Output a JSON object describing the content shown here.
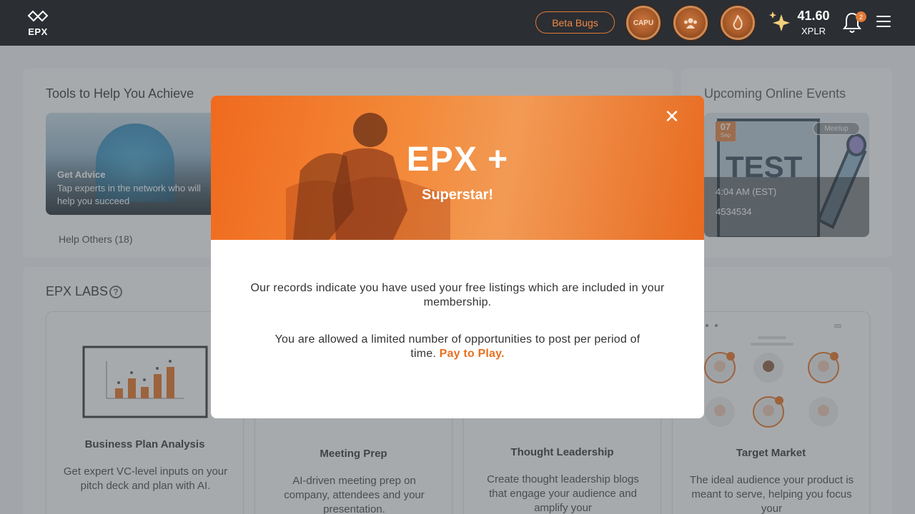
{
  "topbar": {
    "logo_text": "EPX",
    "beta_label": "Beta Bugs",
    "badges": [
      "CAPU",
      "group-badge",
      "flame-badge"
    ],
    "xp_value": "41.60",
    "xp_unit": "XPLR",
    "notification_count": "2"
  },
  "tools": {
    "title": "Tools to Help You Achieve",
    "card_title": "Get Advice",
    "card_desc": "Tap experts in the network who will help you succeed",
    "help_others": "Help Others (18)"
  },
  "events": {
    "title": "Upcoming Online Events",
    "day": "07",
    "month": "Sep",
    "tag": "Meetup",
    "time": "4:04 AM (EST)",
    "name": "4534534"
  },
  "labs": {
    "title": "EPX LABS",
    "help_icon": "?",
    "cards": [
      {
        "title": "Business Plan Analysis",
        "desc": "Get expert VC-level inputs on your pitch deck and plan with AI."
      },
      {
        "title": "Meeting Prep",
        "desc": "AI-driven meeting prep on company, attendees and your presentation."
      },
      {
        "title": "Thought Leadership",
        "desc": "Create thought leadership blogs that engage your audience and amplify your"
      },
      {
        "title": "Target Market",
        "desc": "The ideal audience your product is meant to serve, helping you focus your"
      }
    ]
  },
  "modal": {
    "title": "EPX +",
    "subtitle": "Superstar!",
    "close": "✕",
    "p1": "Our records indicate you have used your free listings which are included in your membership.",
    "p2": "You are allowed a limited number of opportunities to post per period of time.",
    "link": "Pay to Play."
  },
  "colors": {
    "accent": "#e8701e",
    "topbar": "#2b2e33"
  }
}
